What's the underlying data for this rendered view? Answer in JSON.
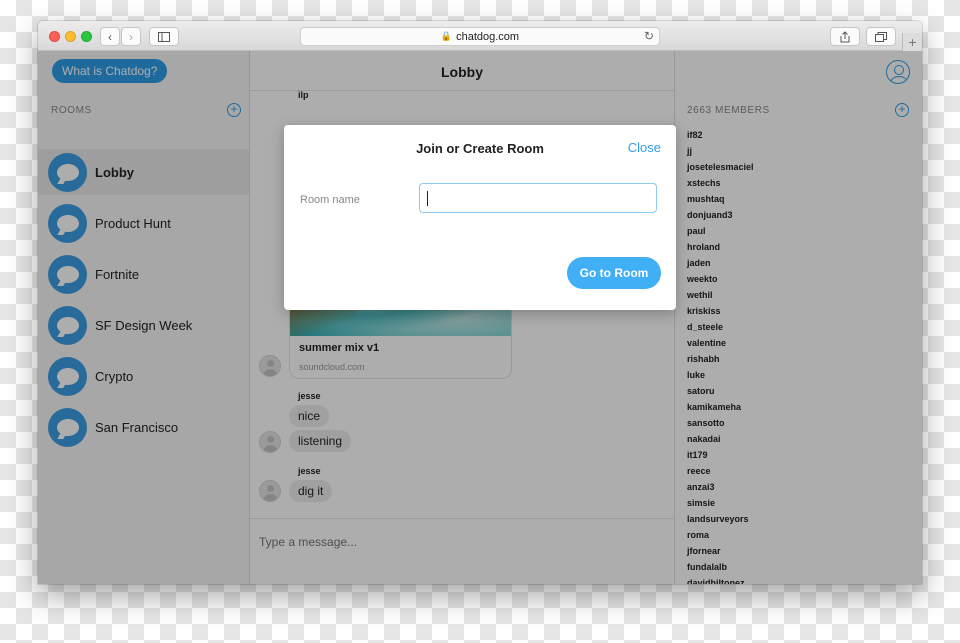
{
  "browser": {
    "url": "chatdog.com"
  },
  "sidebar": {
    "what_button": "What is Chatdog?",
    "rooms_label": "ROOMS",
    "rooms": [
      {
        "label": "Lobby",
        "active": true
      },
      {
        "label": "Product Hunt",
        "active": false
      },
      {
        "label": "Fortnite",
        "active": false
      },
      {
        "label": "SF Design Week",
        "active": false
      },
      {
        "label": "Crypto",
        "active": false
      },
      {
        "label": "San Francisco",
        "active": false
      }
    ]
  },
  "main": {
    "title": "Lobby",
    "top_user": "ilp",
    "card": {
      "title": "summer mix v1",
      "source": "soundcloud.com"
    },
    "messages": [
      {
        "user": "jesse",
        "lines": [
          "nice",
          "listening"
        ]
      },
      {
        "user": "jesse",
        "lines": [
          "dig it"
        ]
      }
    ],
    "composer_placeholder": "Type a message..."
  },
  "members": {
    "label": "2663 MEMBERS",
    "list": [
      "if82",
      "jj",
      "josetelesmaciel",
      "xstechs",
      "mushtaq",
      "donjuand3",
      "paul",
      "hroland",
      "jaden",
      "weekto",
      "wethil",
      "kriskiss",
      "d_steele",
      "valentine",
      "rishabh",
      "luke",
      "satoru",
      "kamikameha",
      "sansotto",
      "nakadai",
      "it179",
      "reece",
      "anzai3",
      "simsie",
      "landsurveyors",
      "roma",
      "jfornear",
      "fundalalb",
      "davidhiltonez"
    ]
  },
  "modal": {
    "title": "Join or Create Room",
    "close": "Close",
    "room_name_label": "Room name",
    "room_name_value": "",
    "go_button": "Go to Room"
  },
  "colors": {
    "accent": "#2f9de8",
    "go_button": "#40aff5"
  }
}
